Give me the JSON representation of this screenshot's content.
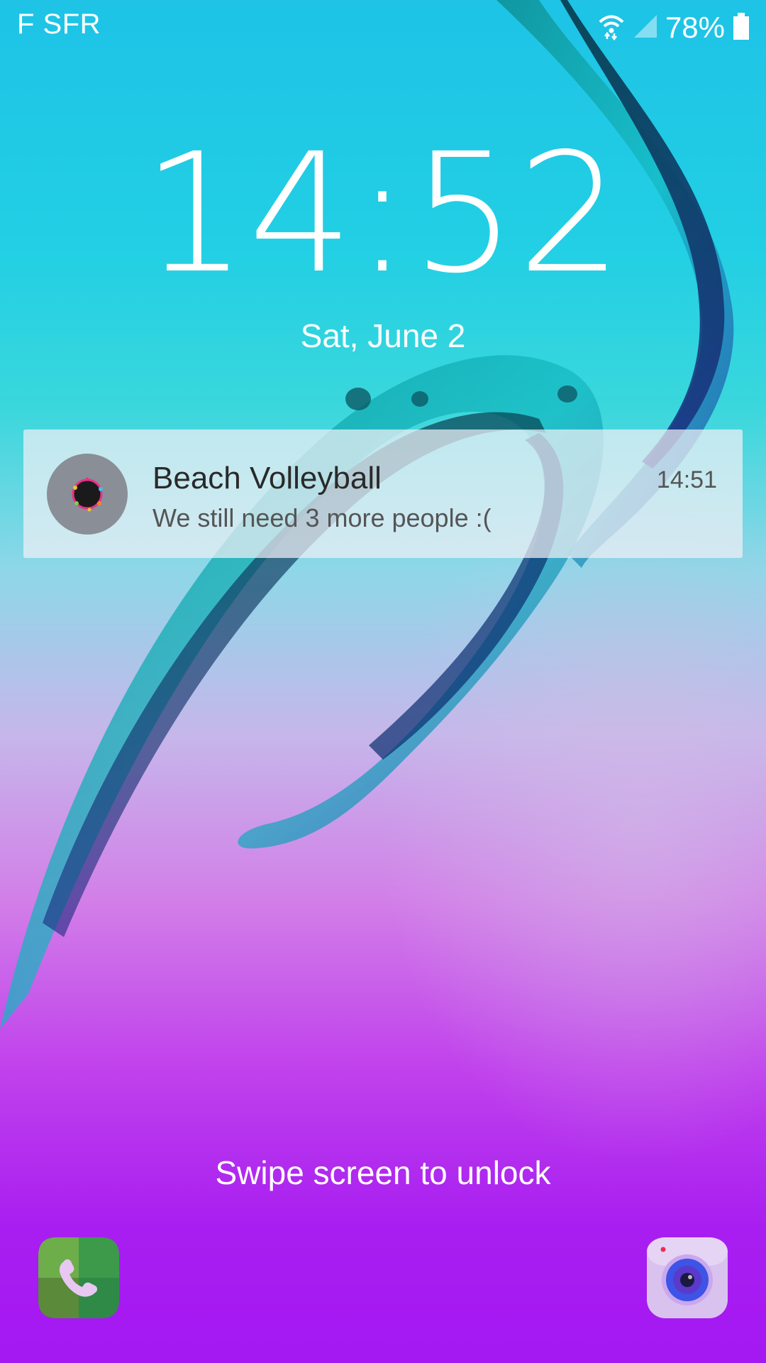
{
  "status_bar": {
    "carrier": "F SFR",
    "battery_percent": "78%",
    "icons": [
      "wifi-icon",
      "signal-icon",
      "battery-icon"
    ]
  },
  "lock_screen": {
    "time": "14:52",
    "date": "Sat, June 2",
    "unlock_hint": "Swipe screen to unlock"
  },
  "notification": {
    "title": "Beach Volleyball",
    "message": "We still need 3 more people :(",
    "time": "14:51",
    "icon": "group-avatar-icon"
  },
  "shortcuts": {
    "left": "phone-icon",
    "right": "camera-icon"
  },
  "colors": {
    "wallpaper_top": "#1ec3e6",
    "wallpaper_bottom": "#a418f2",
    "text": "#ffffff",
    "notification_bg": "#f0f0f5"
  }
}
